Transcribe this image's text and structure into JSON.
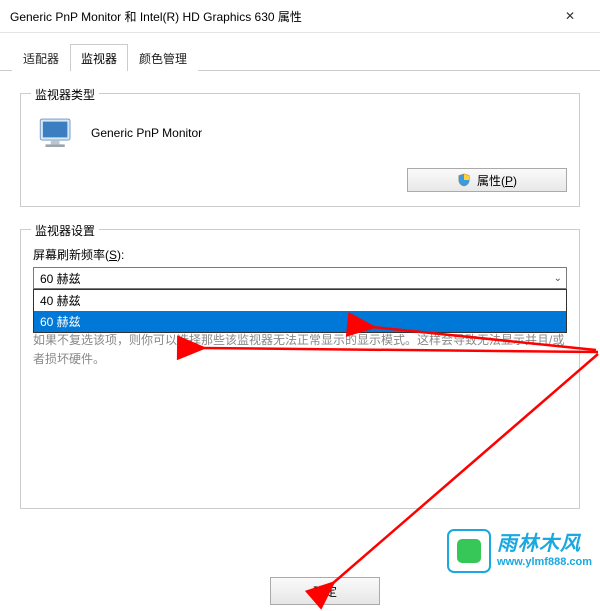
{
  "window": {
    "title": "Generic PnP Monitor 和 Intel(R) HD Graphics 630 属性",
    "close": "✕"
  },
  "tabs": {
    "adapter": "适配器",
    "monitor": "监视器",
    "color": "颜色管理"
  },
  "monitor_type": {
    "legend": "监视器类型",
    "name": "Generic PnP Monitor",
    "properties_button": "属性(P)"
  },
  "monitor_settings": {
    "legend": "监视器设置",
    "refresh_label_pre": "屏幕刷新频率(",
    "refresh_label_key": "S",
    "refresh_label_post": "):",
    "selected": "60 赫兹",
    "options": [
      "40 赫兹",
      "60 赫兹"
    ],
    "hint": "如果不复选该项，则你可以选择那些该监视器无法正常显示的显示模式。这样会导致无法显示并且/或者损坏硬件。"
  },
  "buttons": {
    "ok": "确定"
  },
  "watermark": {
    "title": "雨林木风",
    "url": "www.ylmf888.com"
  },
  "annotation": {
    "color": "#ff0000"
  }
}
